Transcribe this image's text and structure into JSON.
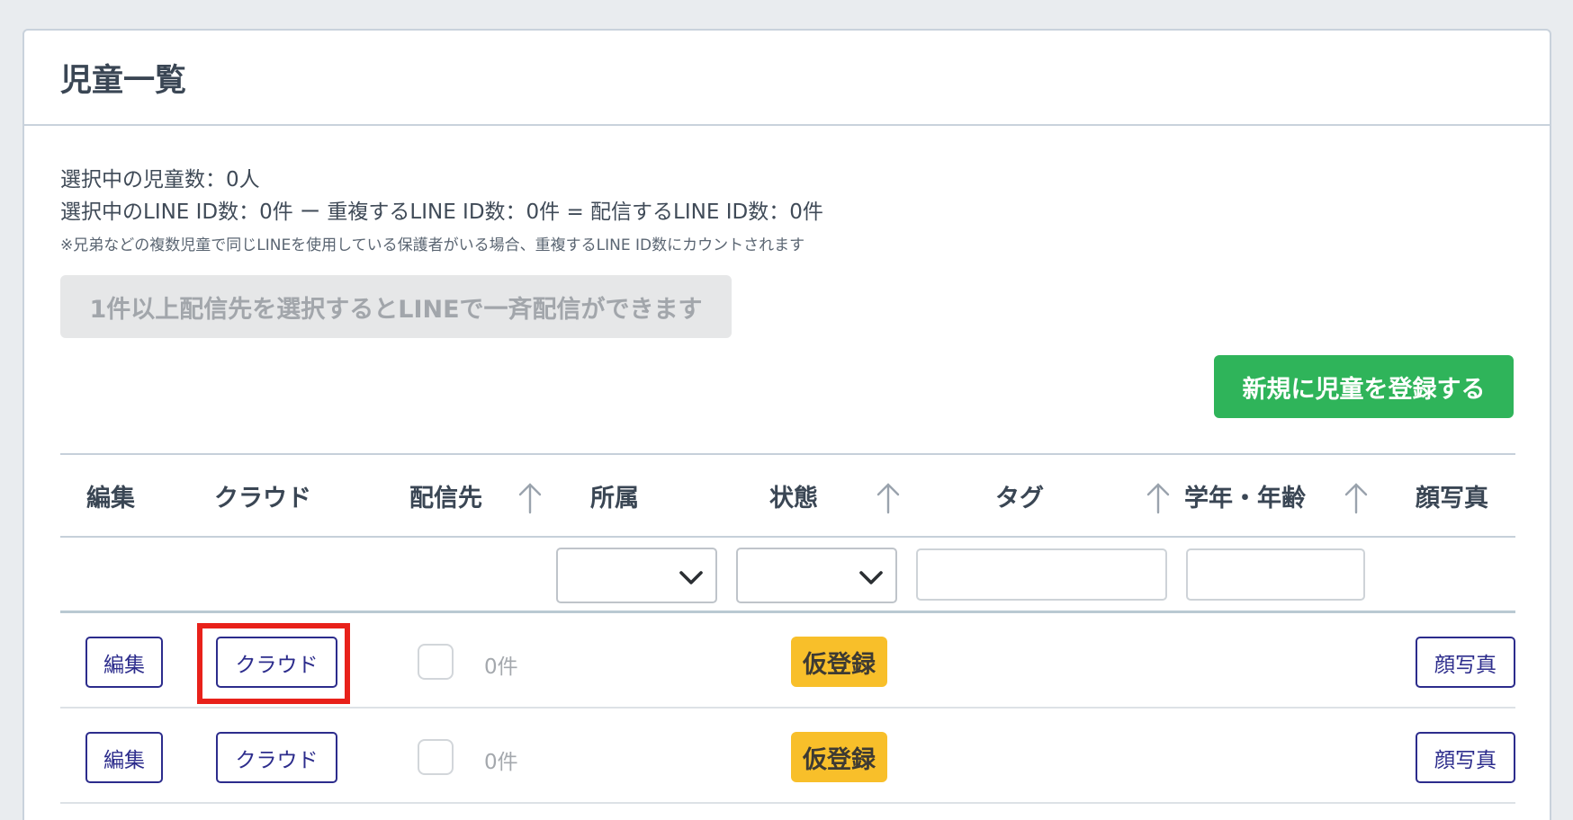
{
  "page": {
    "title": "児童一覧"
  },
  "summary": {
    "selected_children": "選択中の児童数：0人",
    "line_counts": "選択中のLINE ID数：0件 ー 重複するLINE ID数：0件 = 配信するLINE ID数：0件",
    "note": "※兄弟などの複数児童で同じLINEを使用している保護者がいる場合、重複するLINE ID数にカウントされます"
  },
  "actions": {
    "bulk_send_label": "1件以上配信先を選択するとLINEで一斉配信ができます",
    "new_child_label": "新規に児童を登録する"
  },
  "table": {
    "headers": {
      "edit": "編集",
      "cloud": "クラウド",
      "destination": "配信先",
      "affiliation": "所属",
      "status": "状態",
      "tag": "タグ",
      "grade_age": "学年・年齢",
      "photo": "顔写真"
    },
    "filters": {
      "affiliation_value": "",
      "status_value": "",
      "tag_value": "",
      "grade_value": ""
    },
    "rows": [
      {
        "edit": "編集",
        "cloud": "クラウド",
        "count": "0件",
        "status": "仮登録",
        "photo": "顔写真"
      },
      {
        "edit": "編集",
        "cloud": "クラウド",
        "count": "0件",
        "status": "仮登録",
        "photo": "顔写真"
      }
    ]
  },
  "icons": {
    "sort": "arrow-up-icon",
    "dropdown": "chevron-down-icon"
  },
  "colors": {
    "primary_green": "#2fb45a",
    "badge_yellow": "#f8bf2a",
    "outline_button": "#2c2c8c",
    "highlight_red": "#e8211a"
  }
}
